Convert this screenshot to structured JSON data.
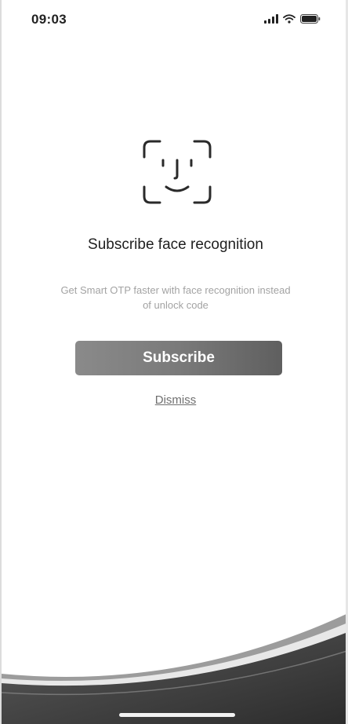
{
  "status_bar": {
    "time": "09:03",
    "icons": [
      "signal-icon",
      "wifi-icon",
      "battery-icon"
    ]
  },
  "main": {
    "icon": "face-id-icon",
    "title": "Subscribe face recognition",
    "subtitle": "Get Smart OTP faster with face recognition instead of unlock code",
    "subscribe_label": "Subscribe",
    "dismiss_label": "Dismiss"
  },
  "colors": {
    "button": "#7a7a7a",
    "button_text": "#ffffff",
    "subtitle": "#a3a3a3",
    "wave": "#3a3a3a"
  }
}
